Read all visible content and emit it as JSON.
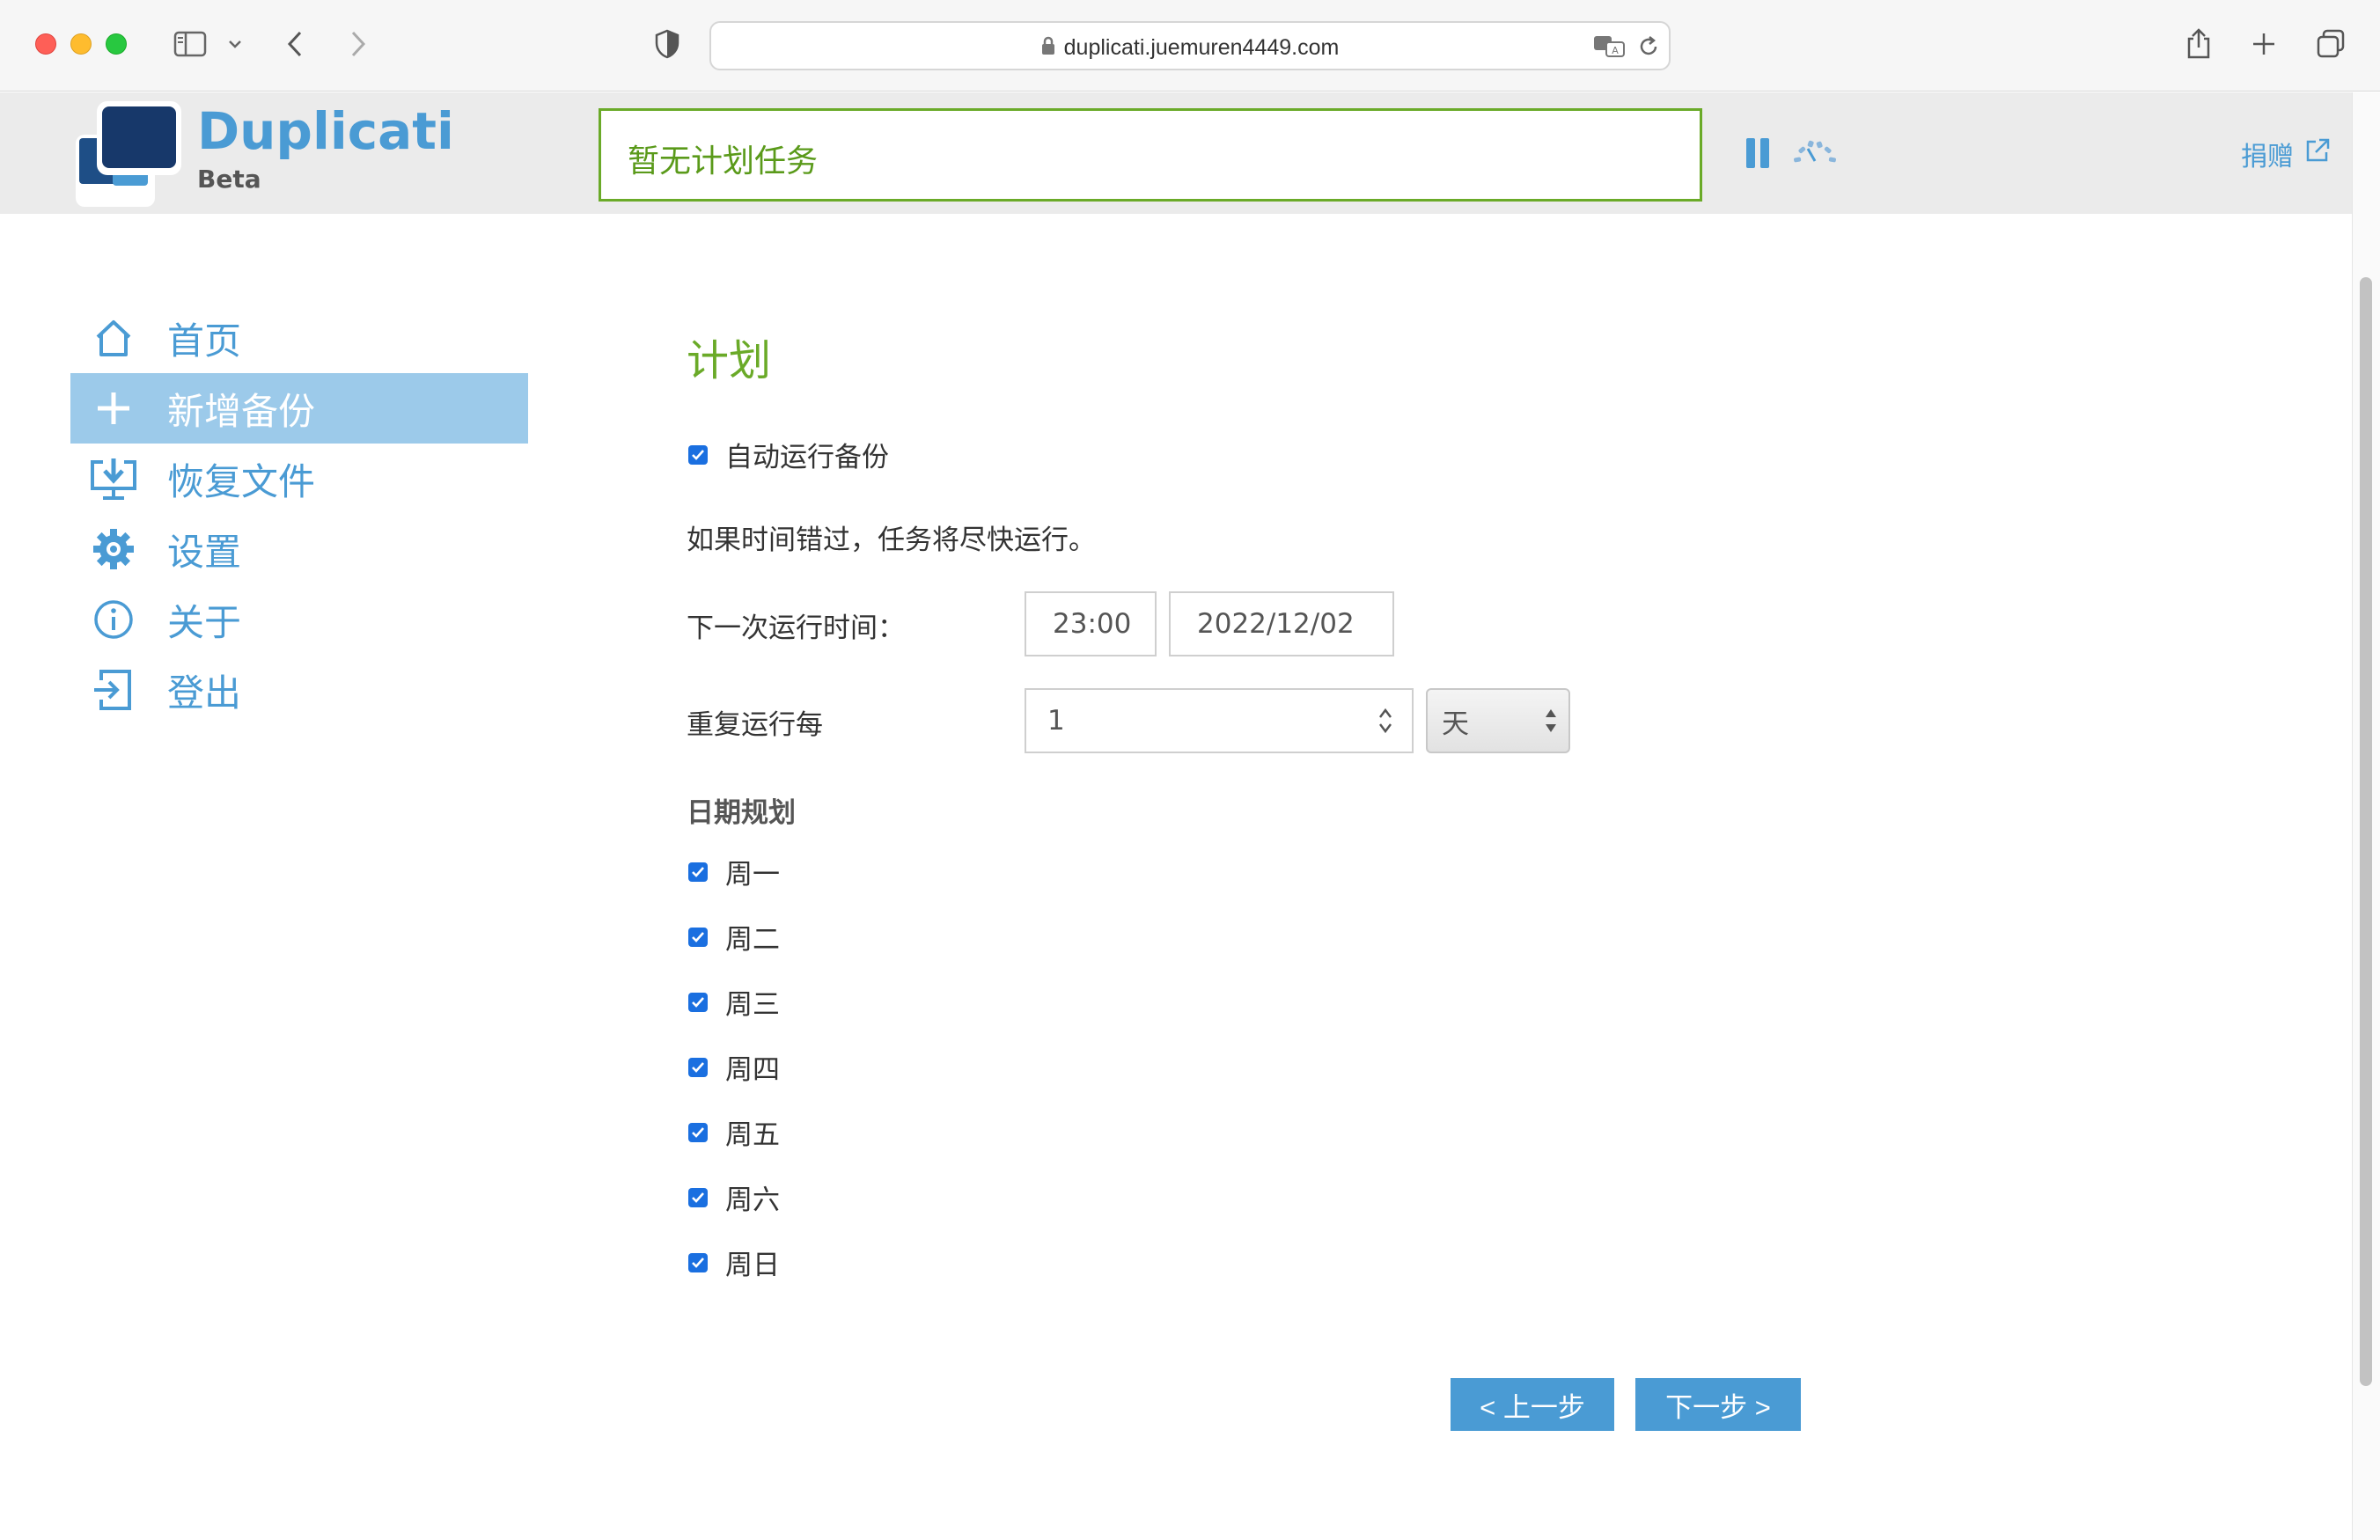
{
  "browser": {
    "url": "duplicati.juemuren4449.com"
  },
  "header": {
    "brand_name": "Duplicati",
    "brand_sub": "Beta",
    "status": "暂无计划任务",
    "donate": "捐赠"
  },
  "sidebar": {
    "items": [
      {
        "label": "首页",
        "icon": "home-icon"
      },
      {
        "label": "新增备份",
        "icon": "plus-icon"
      },
      {
        "label": "恢复文件",
        "icon": "restore-icon"
      },
      {
        "label": "设置",
        "icon": "gear-icon"
      },
      {
        "label": "关于",
        "icon": "info-icon"
      },
      {
        "label": "登出",
        "icon": "logout-icon"
      }
    ],
    "active_index": 1
  },
  "schedule": {
    "title": "计划",
    "auto_run_label": "自动运行备份",
    "auto_run_checked": true,
    "missed_hint": "如果时间错过，任务将尽快运行。",
    "next_run_label": "下一次运行时间：",
    "next_time": "23:00",
    "next_date": "2022/12/02",
    "repeat_label": "重复运行每",
    "repeat_value": "1",
    "repeat_unit": "天",
    "days_heading": "日期规划",
    "days": [
      {
        "label": "周一",
        "checked": true
      },
      {
        "label": "周二",
        "checked": true
      },
      {
        "label": "周三",
        "checked": true
      },
      {
        "label": "周四",
        "checked": true
      },
      {
        "label": "周五",
        "checked": true
      },
      {
        "label": "周六",
        "checked": true
      },
      {
        "label": "周日",
        "checked": true
      }
    ],
    "prev_button": "< 上一步",
    "next_button": "下一步 >"
  },
  "colors": {
    "accent": "#4a9bd4",
    "active_nav": "#9ccaea",
    "green": "#6aaa28",
    "checkbox": "#1a6fe0"
  }
}
